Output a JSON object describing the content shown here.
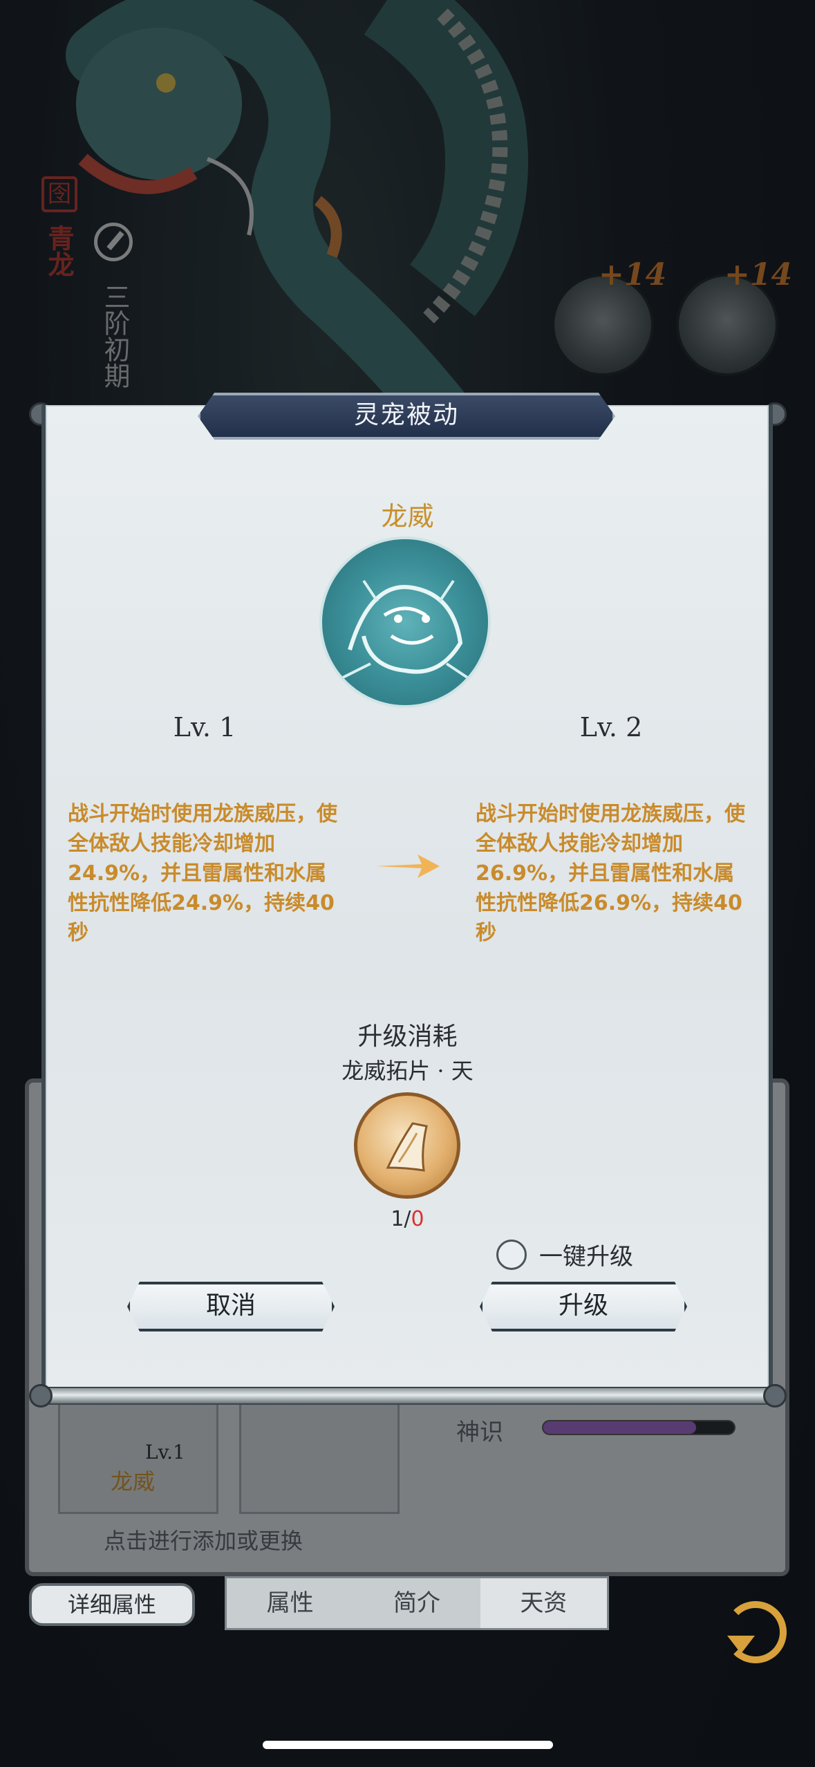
{
  "background": {
    "seal_char": "囹",
    "pet_name": "青龙",
    "stage_text": "三阶初期",
    "equipment": [
      {
        "name": "helmet",
        "plus": "+14"
      },
      {
        "name": "horned-helmet",
        "plus": "+14"
      }
    ],
    "skill_slot": {
      "level": "Lv.1",
      "name": "龙威"
    },
    "hint_text": "点击进行添加或更换",
    "shenshi_label": "神识",
    "shenshi_fill": 0.8,
    "detail_button": "详细属性",
    "tabs": [
      "属性",
      "简介",
      "天资"
    ],
    "active_tab": "天资"
  },
  "dialog": {
    "title": "灵宠被动",
    "skill_name": "龙威",
    "current_level": "Lv. 1",
    "next_level": "Lv. 2",
    "current_desc": "战斗开始时使用龙族威压，使全体敌人技能冷却增加24.9%，并且雷属性和水属性抗性降低24.9%，持续40秒",
    "next_desc": "战斗开始时使用龙族威压，使全体敌人技能冷却增加26.9%，并且雷属性和水属性抗性降低26.9%，持续40秒",
    "cost_title": "升级消耗",
    "cost_item_name": "龙威拓片 · 天",
    "cost_required": "1/",
    "cost_have": "0",
    "oneclick_label": "一键升级",
    "cancel_label": "取消",
    "upgrade_label": "升级"
  },
  "colors": {
    "accent_gold": "#c98b2b",
    "title_plate": "#22304a",
    "insufficient": "#d8332e"
  }
}
